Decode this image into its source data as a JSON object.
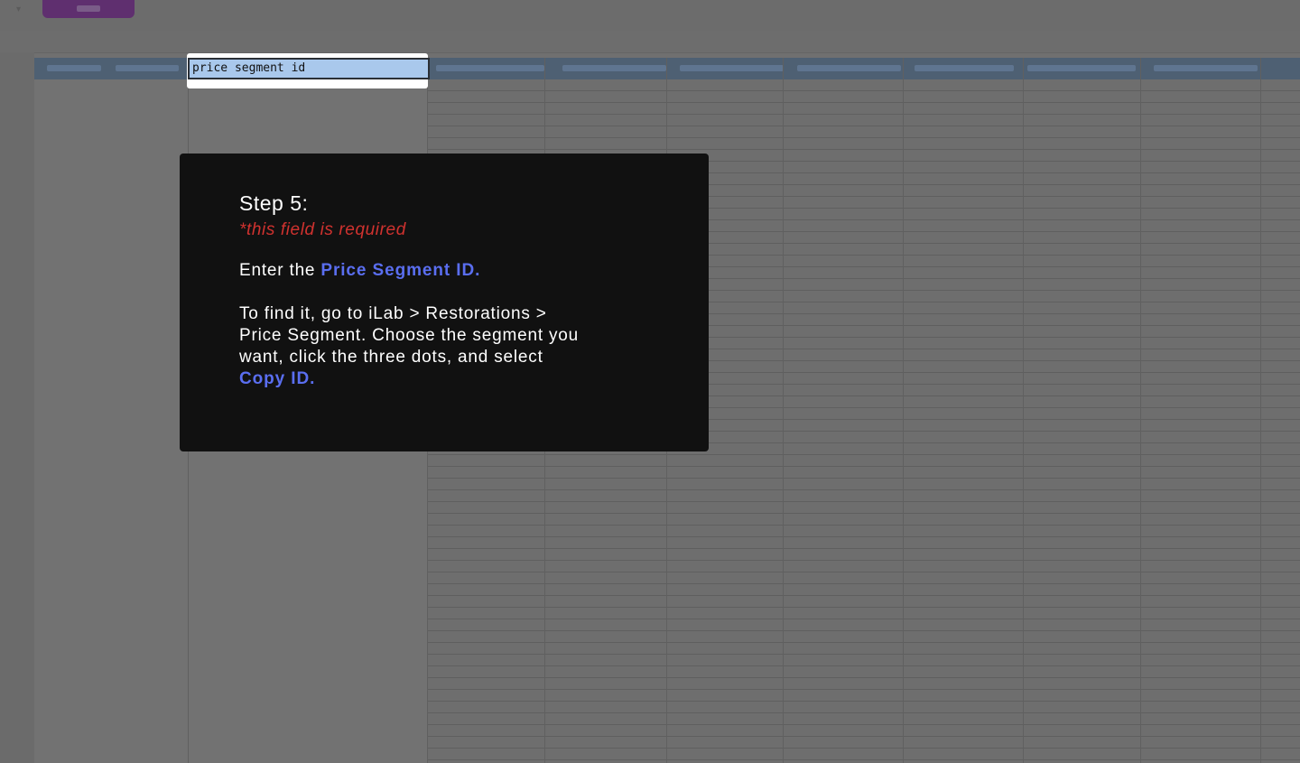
{
  "cell": {
    "value": "price segment id"
  },
  "tooltip": {
    "step": "Step 5:",
    "required_note": "*this field is required",
    "para1_prefix": "Enter the ",
    "para1_highlight": "Price Segment ID.",
    "para2_line1": "To find it, go to iLab > Restorations >",
    "para2_line2": "Price Segment. Choose the segment you",
    "para2_line3": "want, click the three dots, and select",
    "para2_highlight": "Copy ID."
  },
  "colors": {
    "accent": "#5a6ef0",
    "required": "#d0322f",
    "tooltip_bg": "#111111",
    "cell_selected": "#a9c8ec"
  }
}
